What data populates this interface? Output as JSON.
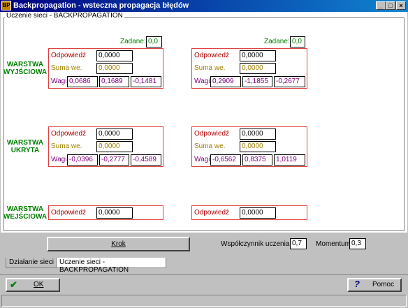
{
  "window": {
    "title": "Backpropagation - wsteczna propagacja błędów",
    "minimize": "_",
    "maximize": "□",
    "close": "×"
  },
  "group_caption": "Uczenie sieci - BACKPROPAGATION",
  "labels": {
    "zadane": "Zadane:",
    "odpowiedz": "Odpowiedź",
    "suma_we": "Suma we.",
    "wagi": "Wagi"
  },
  "layers": {
    "output": "WARSTWA WYJŚCIOWA",
    "hidden": "WARSTWA UKRYTA",
    "input": "WARSTWA WEJŚCIOWA"
  },
  "output_neurons": [
    {
      "zadane": "0,0",
      "odpowiedz": "0,0000",
      "suma": "0,0000",
      "wagi": [
        "0,0686",
        "0,1689",
        "-0,1481"
      ]
    },
    {
      "zadane": "0,0",
      "odpowiedz": "0,0000",
      "suma": "0,0000",
      "wagi": [
        "0,2909",
        "-1,1855",
        "-0,2677"
      ]
    }
  ],
  "hidden_neurons": [
    {
      "odpowiedz": "0,0000",
      "suma": "0,0000",
      "wagi": [
        "-0,0396",
        "-0,2777",
        "-0,4589"
      ]
    },
    {
      "odpowiedz": "0,0000",
      "suma": "0,0000",
      "wagi": [
        "-0,6562",
        "0,8375",
        "1,0119"
      ]
    }
  ],
  "input_neurons": [
    {
      "odpowiedz": "0,0000"
    },
    {
      "odpowiedz": "0,0000"
    }
  ],
  "controls": {
    "krok": "Krok",
    "wspolczynnik_label": "Współczynnik uczenia:",
    "wspolczynnik_value": "0,7",
    "momentum_label": "Momentum:",
    "momentum_value": "0,3"
  },
  "tabs": [
    "Działanie sieci",
    "Uczenie sieci - BACKPROPAGATION"
  ],
  "footer": {
    "ok": "OK",
    "pomoc": "Pomoc"
  },
  "colors": {
    "title_bg": "#000080",
    "red_frame": "#e04040",
    "green": "#008000",
    "purple": "#800080",
    "olive": "#a08000"
  }
}
